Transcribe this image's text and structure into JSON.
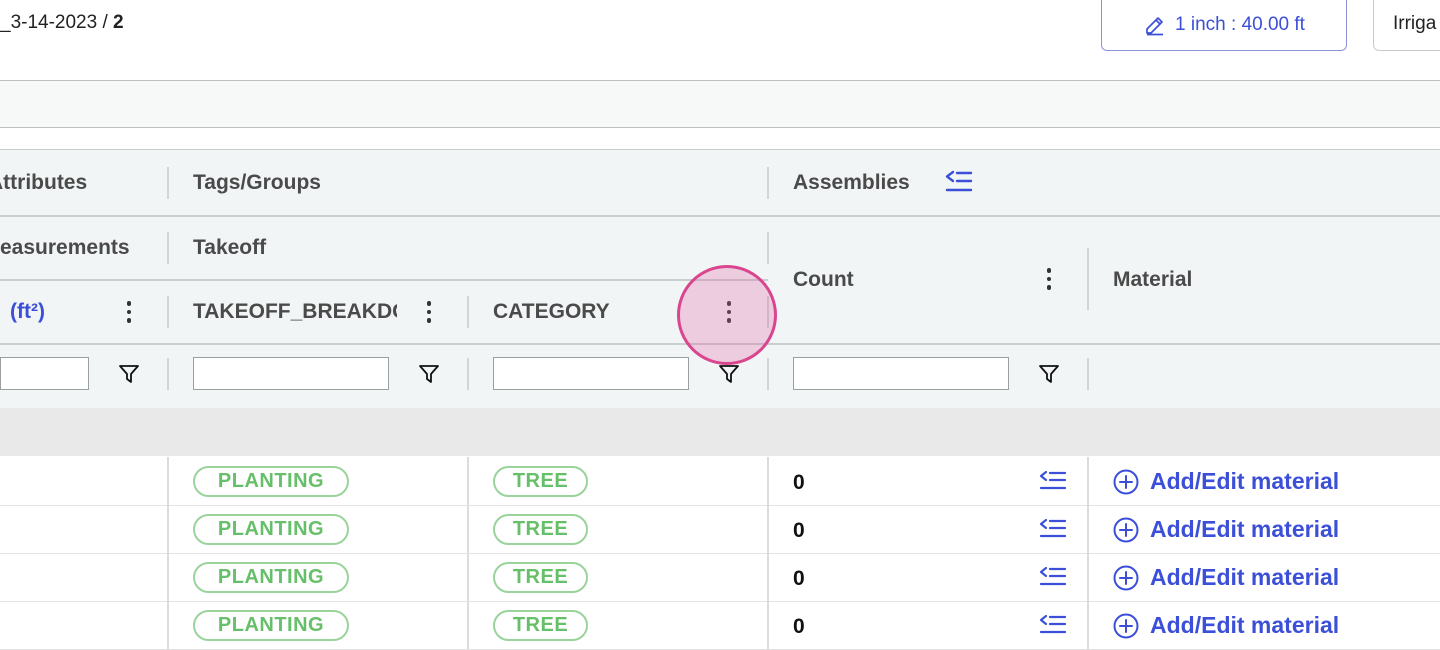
{
  "breadcrumb": {
    "file_fragment": "_3-14-2023",
    "separator": "/",
    "page": "2"
  },
  "scale_button": {
    "label": "1 inch : 40.00 ft",
    "icon": "pencil-icon"
  },
  "dropdown": {
    "label": "Irriga"
  },
  "header": {
    "groups": {
      "attributes": "Attributes",
      "tags_groups": "Tags/Groups",
      "assemblies": "Assemblies",
      "measurements": "easurements",
      "takeoff": "Takeoff"
    },
    "columns": {
      "area_unit": "(ft²)",
      "takeoff_breakdown": "TAKEOFF_BREAKDOWN",
      "category": "CATEGORY",
      "count": "Count",
      "material": "Material"
    }
  },
  "rows": [
    {
      "takeoff_breakdown": "PLANTING",
      "category": "TREE",
      "count": "0",
      "material_action": "Add/Edit material"
    },
    {
      "takeoff_breakdown": "PLANTING",
      "category": "TREE",
      "count": "0",
      "material_action": "Add/Edit material"
    },
    {
      "takeoff_breakdown": "PLANTING",
      "category": "TREE",
      "count": "0",
      "material_action": "Add/Edit material"
    },
    {
      "takeoff_breakdown": "PLANTING",
      "category": "TREE",
      "count": "0",
      "material_action": "Add/Edit material"
    }
  ],
  "colors": {
    "accent": "#3b4fd8",
    "pill_green": "#66bf69",
    "highlight": "#d9458f"
  }
}
